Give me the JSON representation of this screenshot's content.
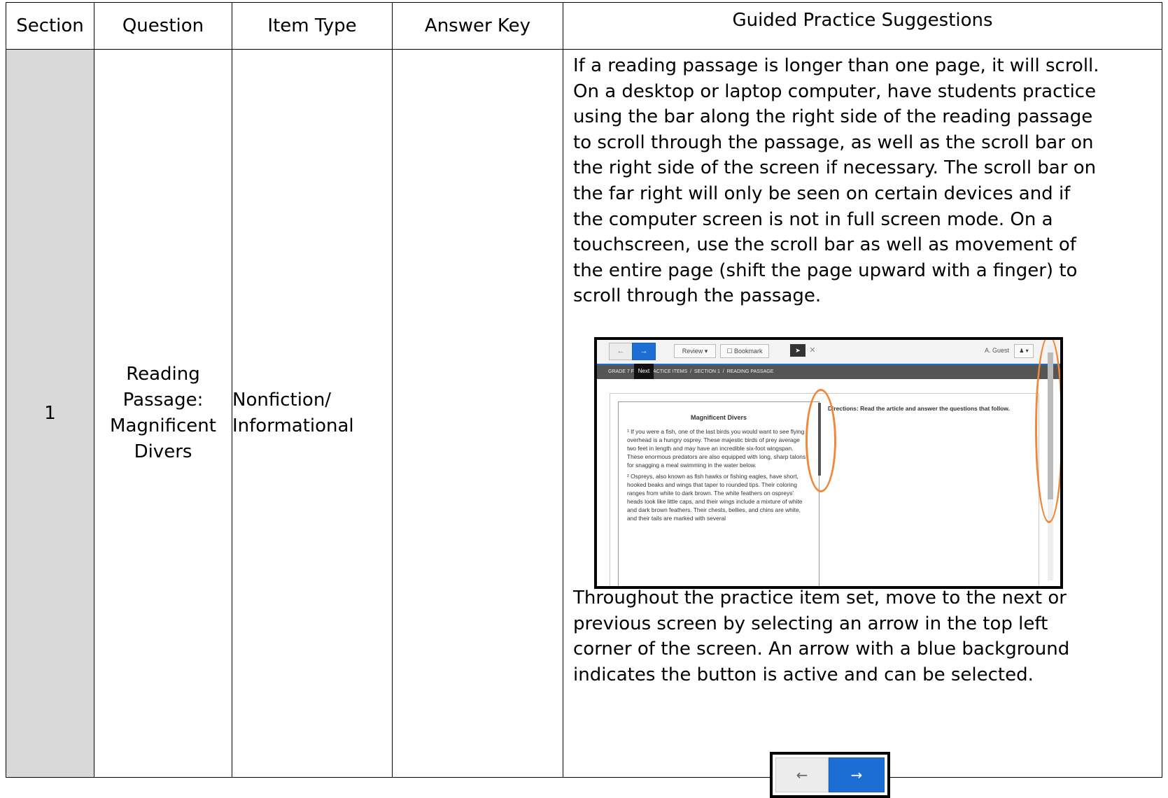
{
  "headers": {
    "section": "Section",
    "question": "Question",
    "item_type": "Item Type",
    "answer_key": "Answer Key",
    "guided": "Guided Practice Suggestions"
  },
  "row": {
    "section": "1",
    "question_lines": [
      "Reading",
      "Passage:",
      "Magnificent",
      "Divers"
    ],
    "item_type_lines": [
      "Nonfiction/",
      "Informational"
    ],
    "answer_key": "",
    "guided_para1": "If a reading passage is longer than one page, it will scroll.  On a desktop or laptop computer, have students practice using the bar along the right side of the reading passage to scroll through the passage, as well as the scroll bar on the right side of the screen if necessary.  The scroll bar on the far right will only be seen on certain devices and if the computer screen is not in full screen mode.  On a touchscreen, use the scroll bar as well as movement of the entire page (shift the page upward with a finger) to scroll through the passage.",
    "guided_para2": "Throughout the practice item set, move to the next or previous screen by selecting an arrow in the top left corner of the screen.  An arrow with a blue background indicates the button is active and can be selected."
  },
  "screenshot": {
    "prev_arrow": "←",
    "next_arrow": "→",
    "review": "Review ▾",
    "bookmark": "☐ Bookmark",
    "pointer": "➤",
    "close": "✕",
    "user": "A. Guest",
    "user_menu": "♟ ▾",
    "tooltip": "Next",
    "breadcrumb": "GRADE 7 F         PRACTICE ITEMS  /  SECTION 1  /  READING PASSAGE",
    "passage_title": "Magnificent Divers",
    "passage_p1": "¹ If you were a fish, one of the last birds you would want to see flying overhead is a hungry osprey. These majestic birds of prey average two feet in length and may have an incredible six-foot wingspan. These enormous predators are also equipped with long, sharp talons for snagging a meal swimming in the water below.",
    "passage_p2": "² Ospreys, also known as fish hawks or fishing eagles, have short, hooked beaks and wings that taper to rounded tips. Their coloring ranges from white to dark brown. The white feathers on ospreys' heads look like little caps, and their wings include a mixture of white and dark brown feathers. Their chests, bellies, and chins are white, and their tails are marked with several",
    "directions": "Directions: Read the article and answer the questions that follow."
  },
  "arrows": {
    "prev": "←",
    "next": "→"
  },
  "colors": {
    "section_bg": "#d9d9d9",
    "active_blue": "#1c6ed4",
    "highlight_orange": "#f0883b"
  }
}
